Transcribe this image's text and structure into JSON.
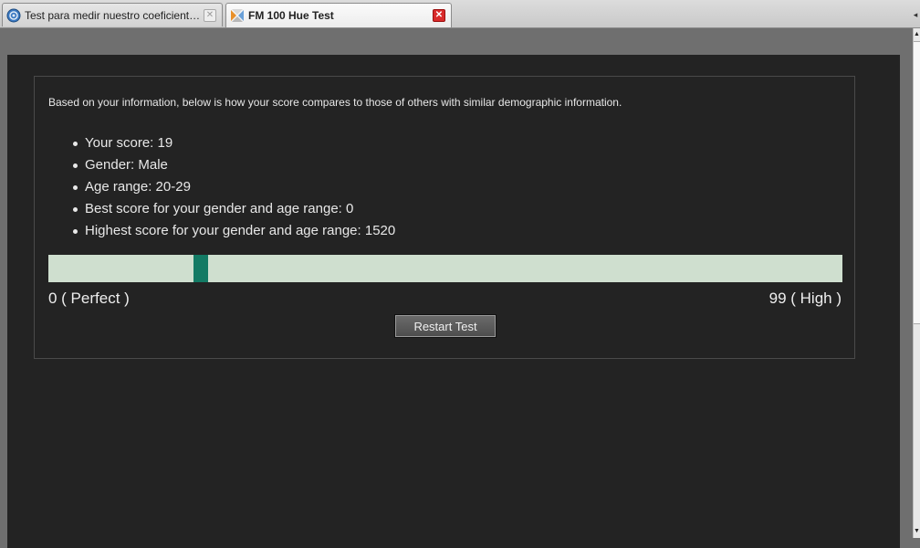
{
  "tabs": [
    {
      "title": "Test para medir nuestro coeficiente Cro...",
      "icon": "globe-icon",
      "active": false
    },
    {
      "title": "FM 100 Hue Test",
      "icon": "fm-logo-icon",
      "active": true
    }
  ],
  "results": {
    "intro": "Based on your information, below is how your score compares to those of others with similar demographic information.",
    "facts": [
      "Your score: 19",
      "Gender: Male",
      "Age range: 20-29",
      "Best score for your gender and age range: 0",
      "Highest score for your gender and age range: 1520"
    ],
    "scale": {
      "min_label": "0 ( Perfect )",
      "max_label": "99 ( High )",
      "min": 0,
      "max": 99,
      "score": 19
    },
    "restart_label": "Restart Test"
  },
  "colors": {
    "page_background": "#232323",
    "bar_background": "#cfdfcf",
    "marker": "#137a64",
    "active_tab_close": "#d92a2a"
  }
}
